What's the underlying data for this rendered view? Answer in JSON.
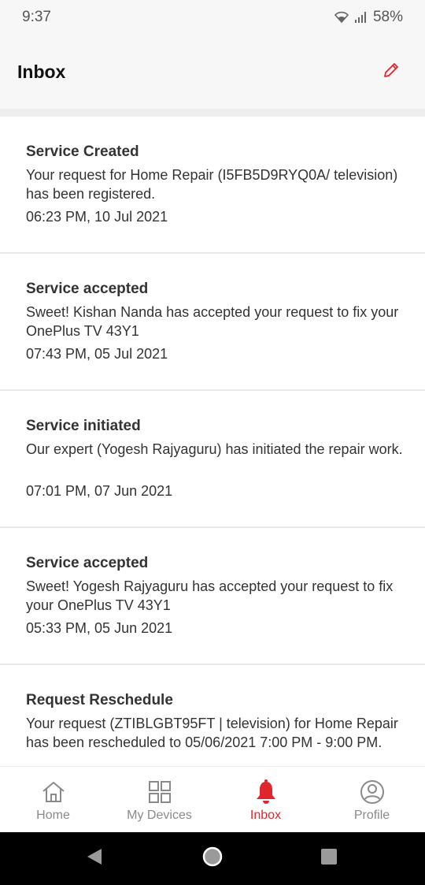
{
  "status_bar": {
    "time": "9:37",
    "battery": "58%"
  },
  "header": {
    "title": "Inbox",
    "edit_icon": "pencil-icon"
  },
  "messages": [
    {
      "title": "Service Created",
      "body": "Your request for Home Repair (I5FB5D9RYQ0A/ television) has been registered.",
      "time": "06:23 PM, 10 Jul 2021"
    },
    {
      "title": "Service accepted",
      "body": "Sweet! Kishan Nanda has accepted your request to fix your OnePlus TV 43Y1",
      "time": "07:43 PM, 05 Jul 2021"
    },
    {
      "title": "Service initiated",
      "body": "Our expert (Yogesh Rajyaguru) has initiated the repair work.",
      "time": "07:01 PM, 07 Jun 2021"
    },
    {
      "title": "Service accepted",
      "body": "Sweet! Yogesh Rajyaguru has accepted your request to fix your OnePlus TV 43Y1",
      "time": "05:33 PM, 05 Jun 2021"
    },
    {
      "title": "Request Reschedule",
      "body": "Your request (ZTIBLGBT95FT | television) for Home Repair has been rescheduled to 05/06/2021 7:00 PM - 9:00 PM.",
      "time": ""
    }
  ],
  "bottom_nav": [
    {
      "label": "Home",
      "icon": "home-icon",
      "active": false
    },
    {
      "label": "My Devices",
      "icon": "grid-icon",
      "active": false
    },
    {
      "label": "Inbox",
      "icon": "bell-icon",
      "active": true
    },
    {
      "label": "Profile",
      "icon": "profile-icon",
      "active": false
    }
  ],
  "colors": {
    "accent": "#e0262c",
    "inactive": "#8a8a8a"
  }
}
